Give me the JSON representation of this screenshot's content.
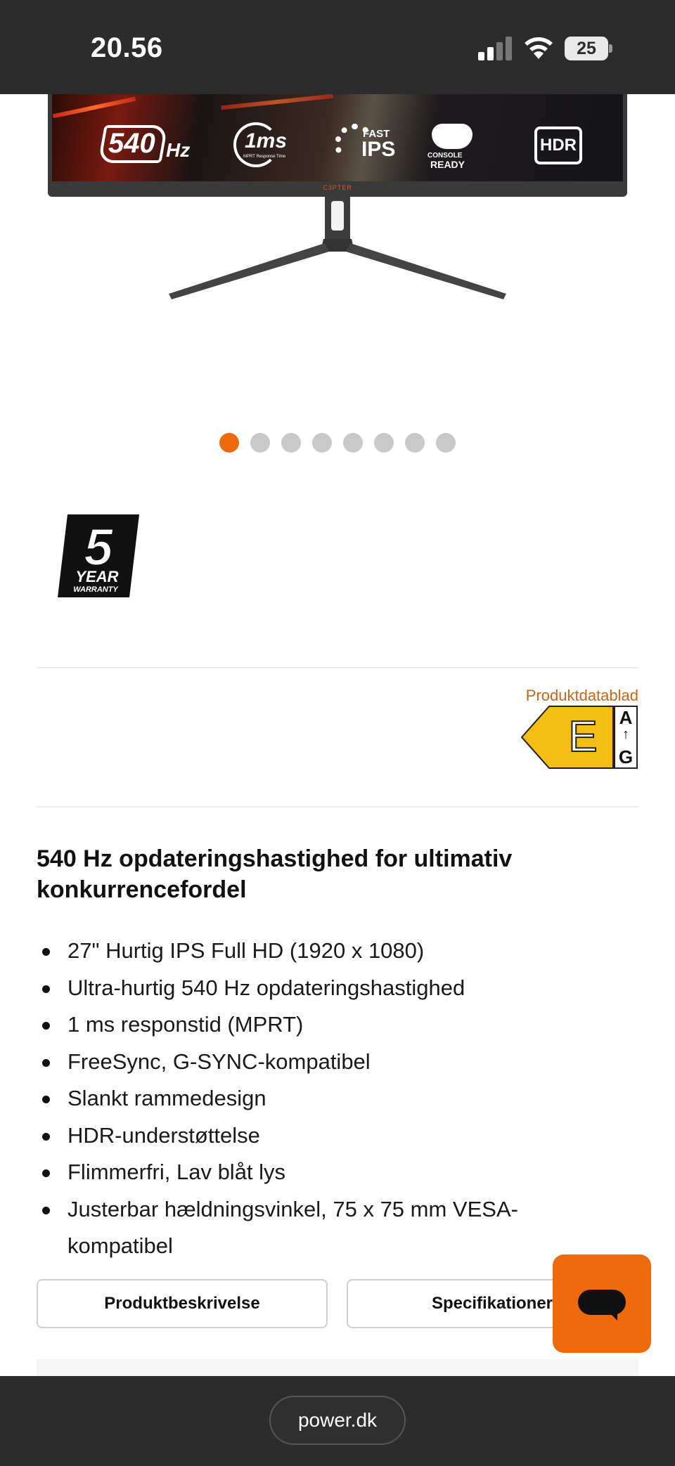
{
  "status_bar": {
    "time": "20.56",
    "battery": "25"
  },
  "product_image": {
    "badges": {
      "refresh_number": "540",
      "refresh_unit": "Hz",
      "response_time": "1ms",
      "response_caption": "MPRT Response Time",
      "panel_top": "FAST",
      "panel_bottom": "IPS",
      "console_top": "CONSOLE",
      "console_bottom": "READY",
      "hdr": "HDR"
    },
    "bezel_brand": "C3PTER"
  },
  "carousel": {
    "total": 8,
    "active_index": 0
  },
  "warranty_badge": {
    "number": "5",
    "line1": "YEAR",
    "line2": "WARRANTY"
  },
  "energy": {
    "datasheet_link": "Produktdatablad",
    "grade": "E",
    "scale_top": "A",
    "scale_arrow": "↑",
    "scale_bottom": "G"
  },
  "headline": "540 Hz opdateringshastighed for ultimativ konkurrencefordel",
  "features": [
    "27\" Hurtig IPS Full HD (1920 x 1080)",
    "Ultra-hurtig 540 Hz opdateringshastighed",
    "1 ms responstid (MPRT)",
    "FreeSync, G-SYNC-kompatibel",
    "Slankt rammedesign",
    "HDR-understøttelse",
    "Flimmerfri, Lav blåt lys",
    "Justerbar hældningsvinkel, 75 x 75 mm VESA-kompatibel"
  ],
  "buttons": {
    "description": "Produktbeskrivelse",
    "specifications": "Specifikationer"
  },
  "browser": {
    "url": "power.dk"
  },
  "colors": {
    "accent": "#ee6a0a",
    "dark_bar": "#2c2c2c",
    "link": "#c9661b",
    "energy_yellow": "#f6be14"
  }
}
